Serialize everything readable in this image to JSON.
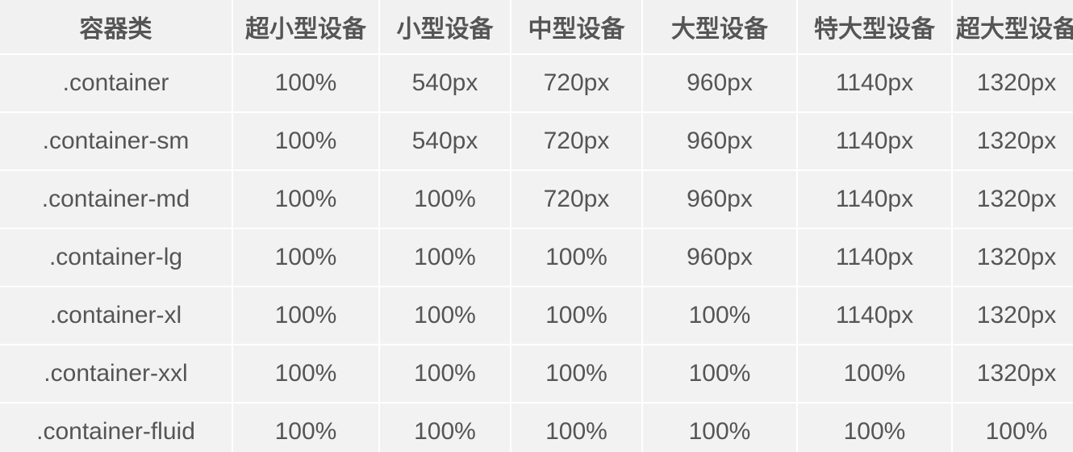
{
  "table": {
    "headers": [
      "容器类",
      "超小型设备",
      "小型设备",
      "中型设备",
      "大型设备",
      "特大型设备",
      "超大型设备"
    ],
    "rows": [
      [
        ".container",
        "100%",
        "540px",
        "720px",
        "960px",
        "1140px",
        "1320px"
      ],
      [
        ".container-sm",
        "100%",
        "540px",
        "720px",
        "960px",
        "1140px",
        "1320px"
      ],
      [
        ".container-md",
        "100%",
        "100%",
        "720px",
        "960px",
        "1140px",
        "1320px"
      ],
      [
        ".container-lg",
        "100%",
        "100%",
        "100%",
        "960px",
        "1140px",
        "1320px"
      ],
      [
        ".container-xl",
        "100%",
        "100%",
        "100%",
        "100%",
        "1140px",
        "1320px"
      ],
      [
        ".container-xxl",
        "100%",
        "100%",
        "100%",
        "100%",
        "100%",
        "1320px"
      ],
      [
        ".container-fluid",
        "100%",
        "100%",
        "100%",
        "100%",
        "100%",
        "100%"
      ]
    ]
  }
}
